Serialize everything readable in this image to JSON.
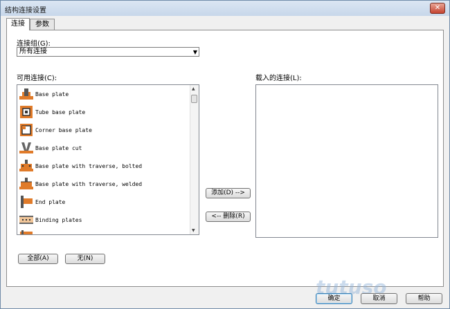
{
  "window": {
    "title": "结构连接设置",
    "close_glyph": "✕"
  },
  "tabs": [
    {
      "label": "连接",
      "active": true
    },
    {
      "label": "参数",
      "active": false
    }
  ],
  "connection_group": {
    "label": "连接组(G):",
    "value": "所有连接"
  },
  "available": {
    "label": "可用连接(C):",
    "items": [
      {
        "label": "Base plate",
        "icon": "base-plate-icon"
      },
      {
        "label": "Tube base plate",
        "icon": "tube-base-plate-icon"
      },
      {
        "label": "Corner base plate",
        "icon": "corner-base-plate-icon"
      },
      {
        "label": "Base plate cut",
        "icon": "base-plate-cut-icon"
      },
      {
        "label": "Base plate with traverse, bolted",
        "icon": "traverse-bolted-icon"
      },
      {
        "label": "Base plate with traverse, welded",
        "icon": "traverse-welded-icon"
      },
      {
        "label": "End plate",
        "icon": "end-plate-icon"
      },
      {
        "label": "Binding plates",
        "icon": "binding-plates-icon"
      }
    ]
  },
  "loaded": {
    "label": "载入的连接(L):"
  },
  "buttons": {
    "add": "添加(D) -->",
    "remove": "<-- 删除(R)",
    "all": "全部(A)",
    "none": "无(N)",
    "ok": "确定",
    "cancel": "取消",
    "help": "帮助"
  },
  "watermark": "tutuso",
  "colors": {
    "icon_orange": "#e07b2a",
    "window_bg": "#f0f0f0",
    "accent": "#3c7fb1"
  }
}
